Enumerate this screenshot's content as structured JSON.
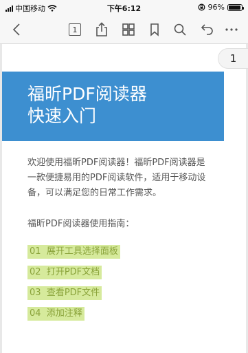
{
  "status_bar": {
    "carrier": "中国移动",
    "time": "下午6:12",
    "battery_percent": "96%",
    "battery_level": 0.96
  },
  "toolbar": {
    "page_number": "1",
    "icons": [
      "back-icon",
      "page-icon",
      "share-icon",
      "thumbnails-icon",
      "bookmark-icon",
      "search-icon",
      "undo-icon",
      "more-icon"
    ]
  },
  "viewer": {
    "page_indicator": "1"
  },
  "document": {
    "title_line1": "福昕PDF阅读器",
    "title_line2": "快速入门",
    "intro_line1": "欢迎使用福昕PDF阅读器！福昕PDF阅读器是",
    "intro_line2": "一款便捷易用的PDF阅读软件，适用于移动设",
    "intro_line3": "备，可以满足您的日常工作需求。",
    "guide_heading": "福昕PDF阅读器使用指南：",
    "steps": [
      {
        "num": "01",
        "text": "展开工具选择面板"
      },
      {
        "num": "02",
        "text": "打开PDF文档"
      },
      {
        "num": "03",
        "text": "查看PDF文件"
      },
      {
        "num": "04",
        "text": "添加注释"
      }
    ],
    "banner_color": "#3d8fd0",
    "highlight_color": "#d6ea9c"
  }
}
